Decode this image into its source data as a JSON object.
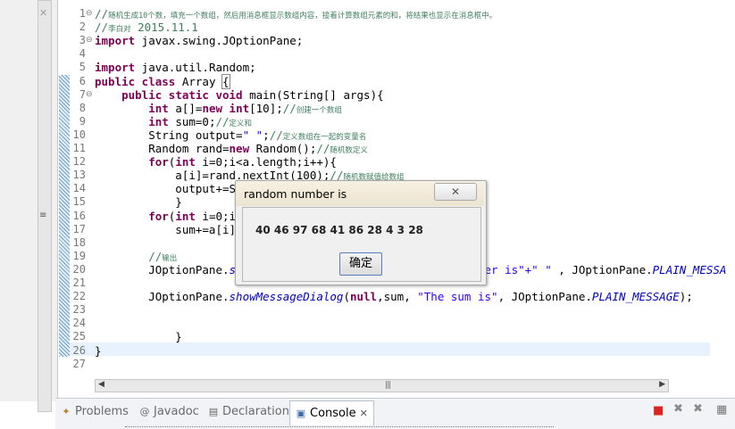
{
  "editor": {
    "line_numbers": [
      "1",
      "2",
      "3",
      "4",
      "5",
      "6",
      "7",
      "8",
      "9",
      "10",
      "11",
      "12",
      "13",
      "14",
      "15",
      "16",
      "17",
      "18",
      "19",
      "20",
      "21",
      "22",
      "23",
      "24",
      "25",
      "26",
      "27"
    ],
    "lines": [
      {
        "n": 1,
        "fold": "⊖",
        "parts": [
          {
            "c": "cm",
            "t": "//"
          },
          {
            "c": "cmsm",
            "t": "随机生成10个数，填充一个数组，然后用消息框显示数组内容，接着计算数组元素的和，将结果也显示在消息框中。"
          }
        ]
      },
      {
        "n": 2,
        "parts": [
          {
            "c": "cm",
            "t": "//"
          },
          {
            "c": "cmsm",
            "t": "李白对"
          },
          {
            "c": "cm",
            "t": " 2015.11.1"
          }
        ]
      },
      {
        "n": 3,
        "fold": "⊖",
        "parts": [
          {
            "c": "kw",
            "t": "import"
          },
          {
            "c": "",
            "t": " javax.swing.JOptionPane;"
          }
        ]
      },
      {
        "n": 4,
        "parts": []
      },
      {
        "n": 5,
        "parts": [
          {
            "c": "kw",
            "t": "import"
          },
          {
            "c": "",
            "t": " java.util.Random;"
          }
        ]
      },
      {
        "n": 6,
        "parts": [
          {
            "c": "kw",
            "t": "public class"
          },
          {
            "c": "",
            "t": " Array "
          },
          {
            "c": "caret",
            "t": "{"
          }
        ]
      },
      {
        "n": 7,
        "fold": "⊖",
        "parts": [
          {
            "c": "",
            "t": "    "
          },
          {
            "c": "kw",
            "t": "public static void"
          },
          {
            "c": "",
            "t": " main(String[] args){"
          }
        ]
      },
      {
        "n": 8,
        "parts": [
          {
            "c": "",
            "t": "        "
          },
          {
            "c": "kw",
            "t": "int"
          },
          {
            "c": "",
            "t": " a[]="
          },
          {
            "c": "kw",
            "t": "new int"
          },
          {
            "c": "",
            "t": "[10];"
          },
          {
            "c": "cm",
            "t": "//"
          },
          {
            "c": "cmsm",
            "t": "创建一个数组"
          }
        ]
      },
      {
        "n": 9,
        "parts": [
          {
            "c": "",
            "t": "        "
          },
          {
            "c": "kw",
            "t": "int"
          },
          {
            "c": "",
            "t": " sum=0;"
          },
          {
            "c": "cm",
            "t": "//"
          },
          {
            "c": "cmsm",
            "t": "定义和"
          }
        ]
      },
      {
        "n": 10,
        "parts": [
          {
            "c": "",
            "t": "        String output="
          },
          {
            "c": "str",
            "t": "\" \""
          },
          {
            "c": "",
            "t": ";"
          },
          {
            "c": "cm",
            "t": "//"
          },
          {
            "c": "cmsm",
            "t": "定义数组在一起的变量名"
          }
        ]
      },
      {
        "n": 11,
        "parts": [
          {
            "c": "",
            "t": "        Random rand="
          },
          {
            "c": "kw",
            "t": "new"
          },
          {
            "c": "",
            "t": " Random();"
          },
          {
            "c": "cm",
            "t": "//"
          },
          {
            "c": "cmsm",
            "t": "随机数定义"
          }
        ]
      },
      {
        "n": 12,
        "parts": [
          {
            "c": "",
            "t": "        "
          },
          {
            "c": "kw",
            "t": "for"
          },
          {
            "c": "",
            "t": "("
          },
          {
            "c": "kw",
            "t": "int"
          },
          {
            "c": "",
            "t": " i=0;i<a.length;i++){"
          }
        ]
      },
      {
        "n": 13,
        "parts": [
          {
            "c": "",
            "t": "            a[i]=rand.nextInt(100);"
          },
          {
            "c": "cm",
            "t": "//"
          },
          {
            "c": "cmsm",
            "t": "随机数赋值给数组"
          }
        ]
      },
      {
        "n": 14,
        "parts": [
          {
            "c": "",
            "t": "            output+=Str"
          }
        ]
      },
      {
        "n": 15,
        "parts": [
          {
            "c": "",
            "t": "            }"
          }
        ]
      },
      {
        "n": 16,
        "parts": [
          {
            "c": "",
            "t": "        "
          },
          {
            "c": "kw",
            "t": "for"
          },
          {
            "c": "",
            "t": "("
          },
          {
            "c": "kw",
            "t": "int"
          },
          {
            "c": "",
            "t": " i=0;i<a"
          }
        ]
      },
      {
        "n": 17,
        "parts": [
          {
            "c": "",
            "t": "            sum+=a[i];"
          }
        ]
      },
      {
        "n": 18,
        "parts": []
      },
      {
        "n": 19,
        "parts": [
          {
            "c": "",
            "t": "        "
          },
          {
            "c": "cm",
            "t": "//"
          },
          {
            "c": "cmsm",
            "t": "输出"
          }
        ]
      },
      {
        "n": 20,
        "parts": [
          {
            "c": "",
            "t": "        JOptionPane."
          },
          {
            "c": "it",
            "t": "sho"
          },
          {
            "c": "",
            "t": "                                   "
          },
          {
            "c": "str",
            "t": "er is\"+\" \""
          },
          {
            "c": "",
            "t": " , JOptionPane."
          },
          {
            "c": "it",
            "t": "PLAIN_MESSA"
          }
        ]
      },
      {
        "n": 21,
        "parts": []
      },
      {
        "n": 22,
        "parts": [
          {
            "c": "",
            "t": "        JOptionPane."
          },
          {
            "c": "it",
            "t": "showMessageDialog"
          },
          {
            "c": "",
            "t": "("
          },
          {
            "c": "kw",
            "t": "null"
          },
          {
            "c": "",
            "t": ",sum, "
          },
          {
            "c": "str",
            "t": "\"The sum is\""
          },
          {
            "c": "",
            "t": ", JOptionPane."
          },
          {
            "c": "it",
            "t": "PLAIN_MESSAGE"
          },
          {
            "c": "",
            "t": ");"
          }
        ]
      },
      {
        "n": 23,
        "parts": []
      },
      {
        "n": 24,
        "parts": []
      },
      {
        "n": 25,
        "parts": [
          {
            "c": "",
            "t": "            }"
          }
        ]
      },
      {
        "n": 26,
        "parts": [
          {
            "c": "",
            "t": "}"
          }
        ]
      },
      {
        "n": 27,
        "parts": []
      }
    ]
  },
  "dialog": {
    "title": "random number is",
    "message": "40 46 97 68 41 86 28 4 3 28",
    "ok_label": "确定",
    "close_symbol": "✕"
  },
  "bottom_tabs": [
    {
      "label": "Problems",
      "icon": "problems-icon",
      "glyph": "✦",
      "active": false
    },
    {
      "label": "Javadoc",
      "icon": "javadoc-icon",
      "glyph": "@",
      "active": false
    },
    {
      "label": "Declaration",
      "icon": "declaration-icon",
      "glyph": "▤",
      "active": false
    },
    {
      "label": "Console",
      "icon": "console-icon",
      "glyph": "▣",
      "active": true
    }
  ],
  "console_close": "✕",
  "colors": {
    "keyword": "#7f0055",
    "comment": "#3f7f5f",
    "string": "#2a00ff",
    "static_italic": "#0000c0"
  }
}
